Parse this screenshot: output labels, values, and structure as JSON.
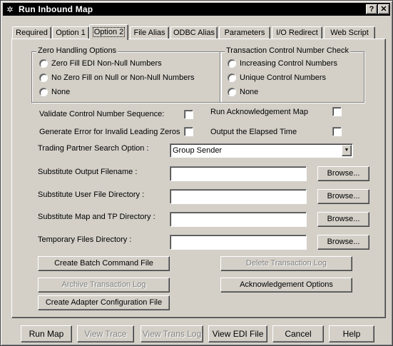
{
  "window": {
    "title": "Run Inbound Map",
    "help_button": "?",
    "close_button": "✕"
  },
  "tabs": [
    {
      "label": "Required"
    },
    {
      "label": "Option 1"
    },
    {
      "label": "Option 2",
      "active": true
    },
    {
      "label": "File Alias"
    },
    {
      "label": "ODBC Alias"
    },
    {
      "label": "Parameters"
    },
    {
      "label": "I/O Redirect"
    },
    {
      "label": "Web Script"
    }
  ],
  "zero_handling": {
    "title": "Zero Handling Options",
    "options": [
      {
        "label": "Zero Fill EDI Non-Null Numbers"
      },
      {
        "label": "No Zero Fill on Null or Non-Null Numbers"
      },
      {
        "label": "None"
      }
    ]
  },
  "tcn_check": {
    "title": "Transaction Control Number Check",
    "options": [
      {
        "label": "Increasing Control Numbers"
      },
      {
        "label": "Unique Control Numbers"
      },
      {
        "label": "None"
      }
    ]
  },
  "checks": {
    "validate_seq": {
      "label": "Validate Control Number Sequence:",
      "checked": false
    },
    "gen_error": {
      "label": "Generate Error for Invalid Leading Zeros",
      "checked": false
    },
    "run_ack_map": {
      "label": "Run Acknowledgement  Map",
      "checked": false
    },
    "elapsed_time": {
      "label": "Output the Elapsed Time",
      "checked": false
    }
  },
  "trading_partner": {
    "label": "Trading Partner Search Option :",
    "value": "Group Sender"
  },
  "fields": {
    "sub_output": {
      "label": "Substitute Output Filename :",
      "value": ""
    },
    "sub_user_dir": {
      "label": "Substitute User File Directory :",
      "value": ""
    },
    "sub_map_dir": {
      "label": "Substitute Map and TP Directory :",
      "value": ""
    },
    "temp_dir": {
      "label": "Temporary Files Directory :",
      "value": ""
    },
    "browse_label": "Browse..."
  },
  "actions": {
    "create_batch": "Create Batch Command File",
    "delete_log": "Delete Transaction Log",
    "archive_log": "Archive Transaction Log",
    "ack_options": "Acknowledgement Options",
    "create_adapter": "Create Adapter Configuration File"
  },
  "bottom": {
    "run_map": "Run Map",
    "view_trace": "View Trace",
    "view_trans_log": "View Trans Log",
    "view_edi_file": "View EDI File",
    "cancel": "Cancel",
    "help": "Help"
  }
}
